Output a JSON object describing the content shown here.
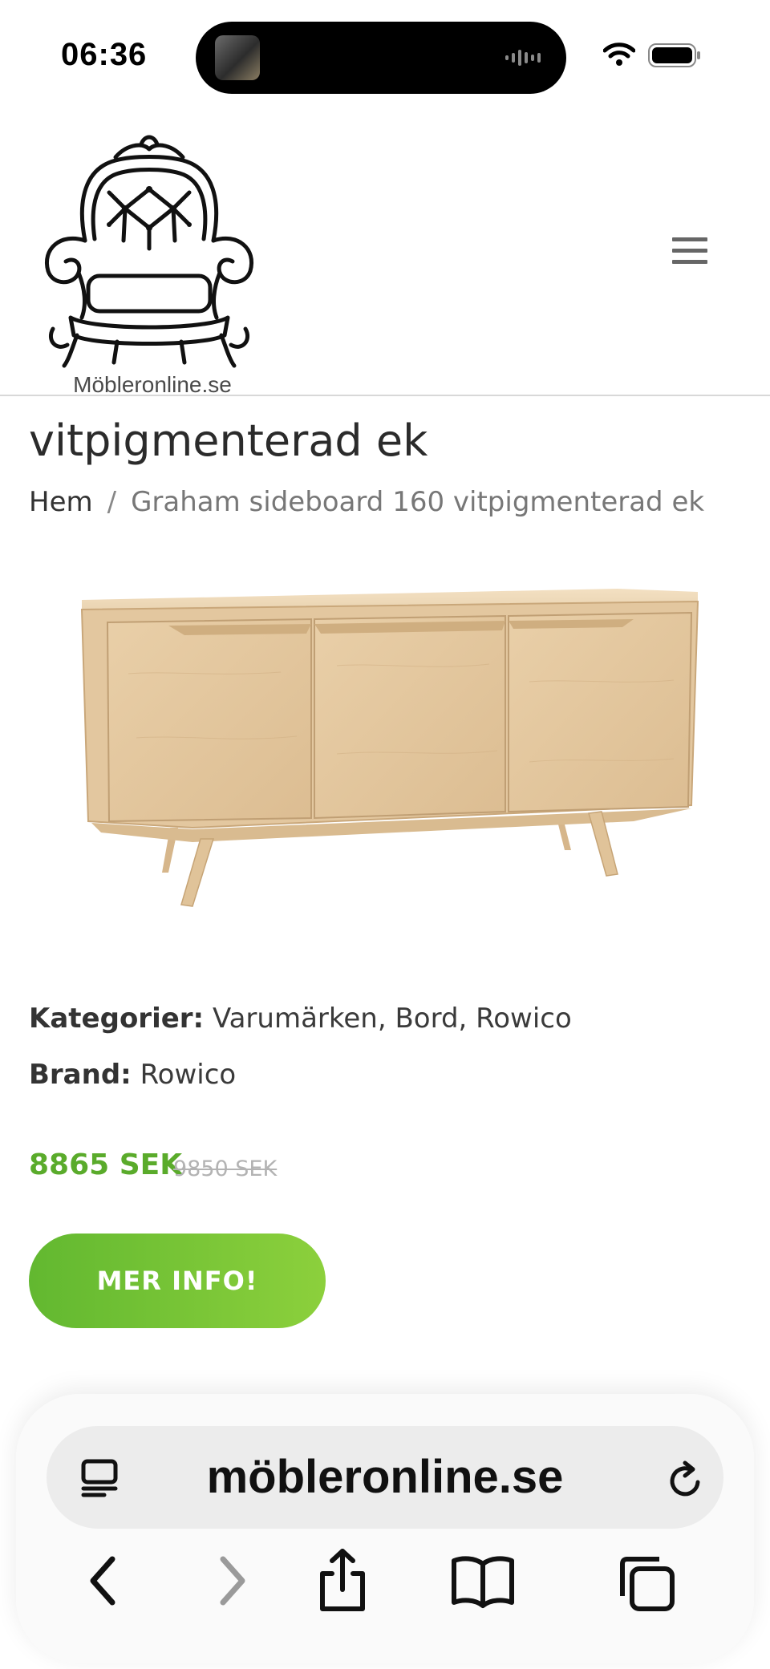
{
  "status_bar": {
    "time": "06:36",
    "icons": [
      "island-thumbnail",
      "audio-waveform-icon",
      "wifi-icon",
      "battery-icon"
    ]
  },
  "header": {
    "logo_text": "Möbleronline.se",
    "logo_icon": "armchair-logo",
    "menu_icon": "hamburger-menu-icon"
  },
  "page": {
    "title": "vitpigmenterad ek",
    "breadcrumb": {
      "home": "Hem",
      "separator": "/",
      "current": "Graham sideboard 160 vitpigmenterad ek"
    }
  },
  "product": {
    "image_alt": "Graham sideboard 160 vitpigmenterad ek",
    "categories_label": "Kategorier:",
    "categories": "Varumärken, Bord, Rowico",
    "brand_label": "Brand:",
    "brand": "Rowico",
    "price_current": "8865 SEK",
    "price_old": "9850 SEK",
    "button_label": "MER INFO!"
  },
  "browser": {
    "address": "möbleronline.se",
    "toolbar": [
      "back-icon",
      "forward-icon",
      "share-icon",
      "bookmarks-icon",
      "tabs-icon"
    ]
  },
  "colors": {
    "accent_green": "#5aab2b",
    "button_green_start": "#62b830",
    "button_green_end": "#8cd03c"
  }
}
